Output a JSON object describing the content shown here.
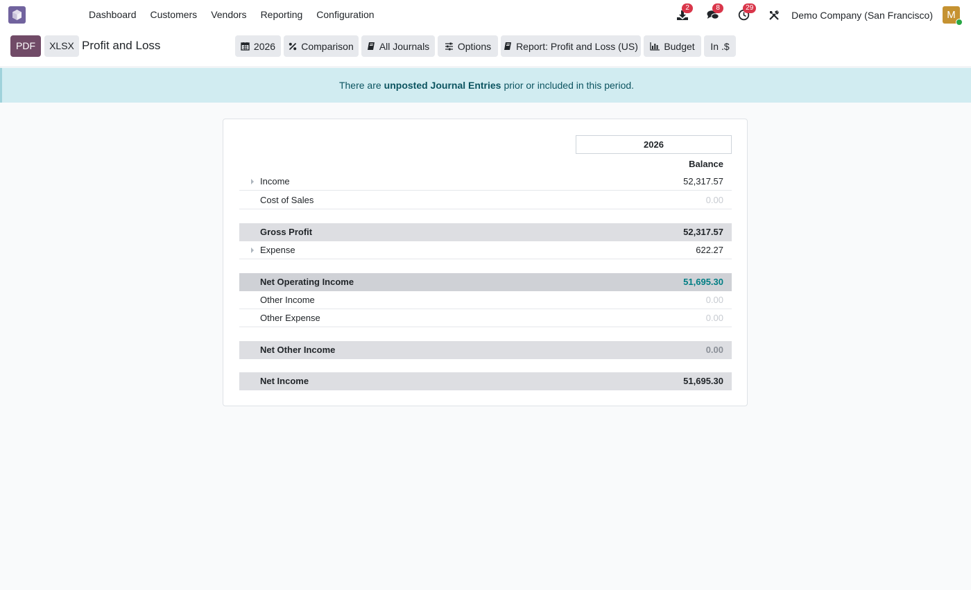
{
  "navbar": {
    "menu": [
      "Dashboard",
      "Customers",
      "Vendors",
      "Reporting",
      "Configuration"
    ],
    "badges": {
      "downloads": "2",
      "messages": "8",
      "activities": "29"
    },
    "company": "Demo Company (San Francisco)",
    "avatar_initial": "M"
  },
  "toolbar": {
    "pdf_label": "PDF",
    "xlsx_label": "XLSX",
    "title": "Profit and Loss",
    "filters": {
      "date": "2026",
      "comparison": "Comparison",
      "journals": "All Journals",
      "options": "Options",
      "report": "Report: Profit and Loss (US)",
      "budget": "Budget",
      "currency": "In .$"
    }
  },
  "alert": {
    "prefix": "There are",
    "link": "unposted Journal Entries",
    "suffix": "prior or included in this period."
  },
  "report": {
    "column_header": "2026",
    "column_subheader": "Balance",
    "lines": [
      {
        "label": "Income",
        "value": "52,317.57",
        "kind": "line",
        "expandable": true
      },
      {
        "label": "Cost of Sales",
        "value": "0.00",
        "kind": "line-muted",
        "expandable": false
      },
      {
        "label": "Gross Profit",
        "value": "52,317.57",
        "kind": "total"
      },
      {
        "label": "Expense",
        "value": "622.27",
        "kind": "line",
        "expandable": true
      },
      {
        "label": "Net Operating Income",
        "value": "51,695.30",
        "kind": "total-highlight"
      },
      {
        "label": "Other Income",
        "value": "0.00",
        "kind": "line-muted",
        "expandable": false
      },
      {
        "label": "Other Expense",
        "value": "0.00",
        "kind": "line-muted",
        "expandable": false
      },
      {
        "label": "Net Other Income",
        "value": "0.00",
        "kind": "total-zero"
      },
      {
        "label": "Net Income",
        "value": "51,695.30",
        "kind": "total"
      }
    ]
  },
  "colors": {
    "brand": "#714b67",
    "alert_bg": "#d1ecf1",
    "alert_text": "#0c5460",
    "positive_total": "#017e84",
    "badge": "#d9364a"
  }
}
